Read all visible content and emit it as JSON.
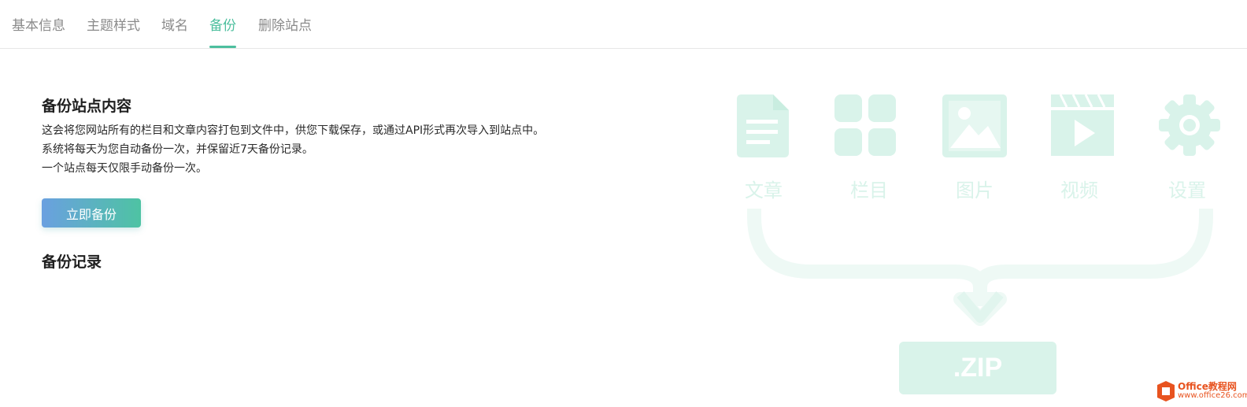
{
  "tabs": [
    {
      "label": "基本信息",
      "active": false
    },
    {
      "label": "主题样式",
      "active": false
    },
    {
      "label": "域名",
      "active": false
    },
    {
      "label": "备份",
      "active": true
    },
    {
      "label": "删除站点",
      "active": false
    }
  ],
  "backup": {
    "title": "备份站点内容",
    "description": [
      "这会将您网站所有的栏目和文章内容打包到文件中，供您下载保存，或通过API形式再次导入到站点中。",
      "系统将每天为您自动备份一次，并保留近7天备份记录。",
      "一个站点每天仅限手动备份一次。"
    ],
    "button_label": "立即备份",
    "records_title": "备份记录"
  },
  "illustration": {
    "items": [
      {
        "label": "文章",
        "icon": "document-icon"
      },
      {
        "label": "栏目",
        "icon": "grid-icon"
      },
      {
        "label": "图片",
        "icon": "image-icon"
      },
      {
        "label": "视频",
        "icon": "video-icon"
      },
      {
        "label": "设置",
        "icon": "gear-icon"
      }
    ],
    "zip_label": ".ZIP",
    "color": "#d9f3ea"
  },
  "watermark": {
    "title": "Office教程网",
    "site": "www.office26.com"
  },
  "colors": {
    "accent": "#4dbf9e",
    "button_gradient_start": "#6aa0e0",
    "button_gradient_end": "#4ec3a3"
  }
}
